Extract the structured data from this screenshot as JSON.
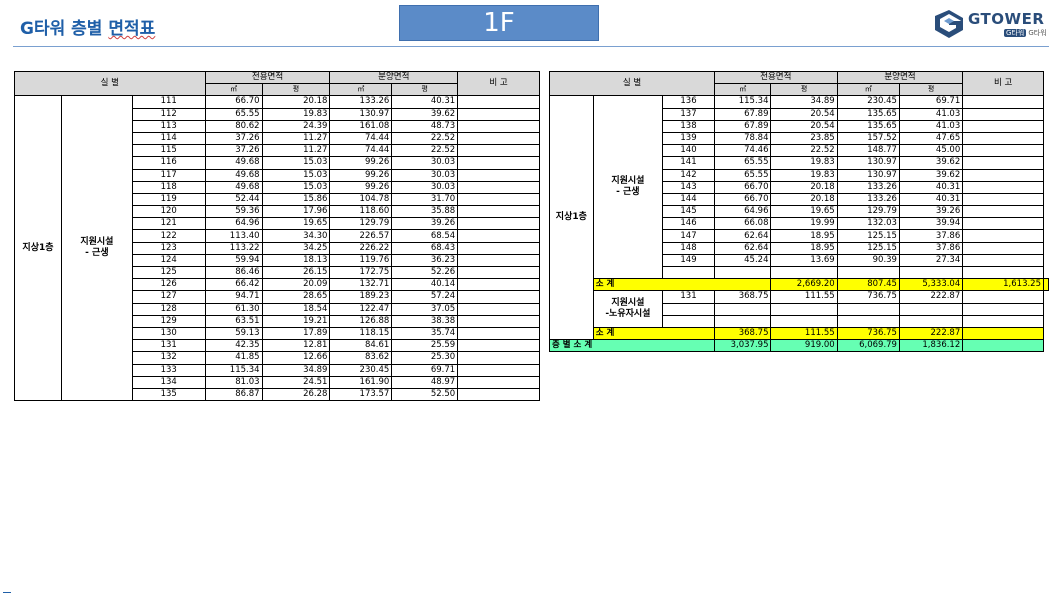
{
  "header": {
    "title_prefix": "G타워 층별 ",
    "title_suffix": "면적표",
    "floor_label": "1F",
    "logo_text": "GTOWER",
    "logo_badge": "G타워",
    "logo_sub": "G타워"
  },
  "table_headers": {
    "room": "실 별",
    "exclusive_area": "전용면적",
    "sale_area": "분양면적",
    "note": "비 고",
    "sqm": "㎡",
    "pyeong": "평"
  },
  "left_table": {
    "floor_label": "지상1층",
    "use_label_line1": "지원시설",
    "use_label_line2": "- 근생",
    "rows": [
      [
        "111",
        "66.70",
        "20.18",
        "133.26",
        "40.31"
      ],
      [
        "112",
        "65.55",
        "19.83",
        "130.97",
        "39.62"
      ],
      [
        "113",
        "80.62",
        "24.39",
        "161.08",
        "48.73"
      ],
      [
        "114",
        "37.26",
        "11.27",
        "74.44",
        "22.52"
      ],
      [
        "115",
        "37.26",
        "11.27",
        "74.44",
        "22.52"
      ],
      [
        "116",
        "49.68",
        "15.03",
        "99.26",
        "30.03"
      ],
      [
        "117",
        "49.68",
        "15.03",
        "99.26",
        "30.03"
      ],
      [
        "118",
        "49.68",
        "15.03",
        "99.26",
        "30.03"
      ],
      [
        "119",
        "52.44",
        "15.86",
        "104.78",
        "31.70"
      ],
      [
        "120",
        "59.36",
        "17.96",
        "118.60",
        "35.88"
      ],
      [
        "121",
        "64.96",
        "19.65",
        "129.79",
        "39.26"
      ],
      [
        "122",
        "113.40",
        "34.30",
        "226.57",
        "68.54"
      ],
      [
        "123",
        "113.22",
        "34.25",
        "226.22",
        "68.43"
      ],
      [
        "124",
        "59.94",
        "18.13",
        "119.76",
        "36.23"
      ],
      [
        "125",
        "86.46",
        "26.15",
        "172.75",
        "52.26"
      ],
      [
        "126",
        "66.42",
        "20.09",
        "132.71",
        "40.14"
      ],
      [
        "127",
        "94.71",
        "28.65",
        "189.23",
        "57.24"
      ],
      [
        "128",
        "61.30",
        "18.54",
        "122.47",
        "37.05"
      ],
      [
        "129",
        "63.51",
        "19.21",
        "126.88",
        "38.38"
      ],
      [
        "130",
        "59.13",
        "17.89",
        "118.15",
        "35.74"
      ],
      [
        "131",
        "42.35",
        "12.81",
        "84.61",
        "25.59"
      ],
      [
        "132",
        "41.85",
        "12.66",
        "83.62",
        "25.30"
      ],
      [
        "133",
        "115.34",
        "34.89",
        "230.45",
        "69.71"
      ],
      [
        "134",
        "81.03",
        "24.51",
        "161.90",
        "48.97"
      ],
      [
        "135",
        "86.87",
        "26.28",
        "173.57",
        "52.50"
      ]
    ]
  },
  "right_table": {
    "floor_label": "지상1층",
    "use_label_line1": "지원시설",
    "use_label_line2": "- 근생",
    "rows": [
      [
        "136",
        "115.34",
        "34.89",
        "230.45",
        "69.71"
      ],
      [
        "137",
        "67.89",
        "20.54",
        "135.65",
        "41.03"
      ],
      [
        "138",
        "67.89",
        "20.54",
        "135.65",
        "41.03"
      ],
      [
        "139",
        "78.84",
        "23.85",
        "157.52",
        "47.65"
      ],
      [
        "140",
        "74.46",
        "22.52",
        "148.77",
        "45.00"
      ],
      [
        "141",
        "65.55",
        "19.83",
        "130.97",
        "39.62"
      ],
      [
        "142",
        "65.55",
        "19.83",
        "130.97",
        "39.62"
      ],
      [
        "143",
        "66.70",
        "20.18",
        "133.26",
        "40.31"
      ],
      [
        "144",
        "66.70",
        "20.18",
        "133.26",
        "40.31"
      ],
      [
        "145",
        "64.96",
        "19.65",
        "129.79",
        "39.26"
      ],
      [
        "146",
        "66.08",
        "19.99",
        "132.03",
        "39.94"
      ],
      [
        "147",
        "62.64",
        "18.95",
        "125.15",
        "37.86"
      ],
      [
        "148",
        "62.64",
        "18.95",
        "125.15",
        "37.86"
      ],
      [
        "149",
        "45.24",
        "13.69",
        "90.39",
        "27.34"
      ]
    ],
    "subtotal1": {
      "label": "소 계",
      "values": [
        "2,669.20",
        "807.45",
        "5,333.04",
        "1,613.25"
      ]
    },
    "group2": {
      "use_label_line1": "지원시설",
      "use_label_line2": "-노유자시설",
      "row": [
        "131",
        "368.75",
        "111.55",
        "736.75",
        "222.87"
      ]
    },
    "subtotal2": {
      "label": "소 계",
      "values": [
        "368.75",
        "111.55",
        "736.75",
        "222.87"
      ]
    },
    "floor_total": {
      "label": "층 별 소 계",
      "values": [
        "3,037.95",
        "919.00",
        "6,069.79",
        "1,836.12"
      ]
    }
  }
}
